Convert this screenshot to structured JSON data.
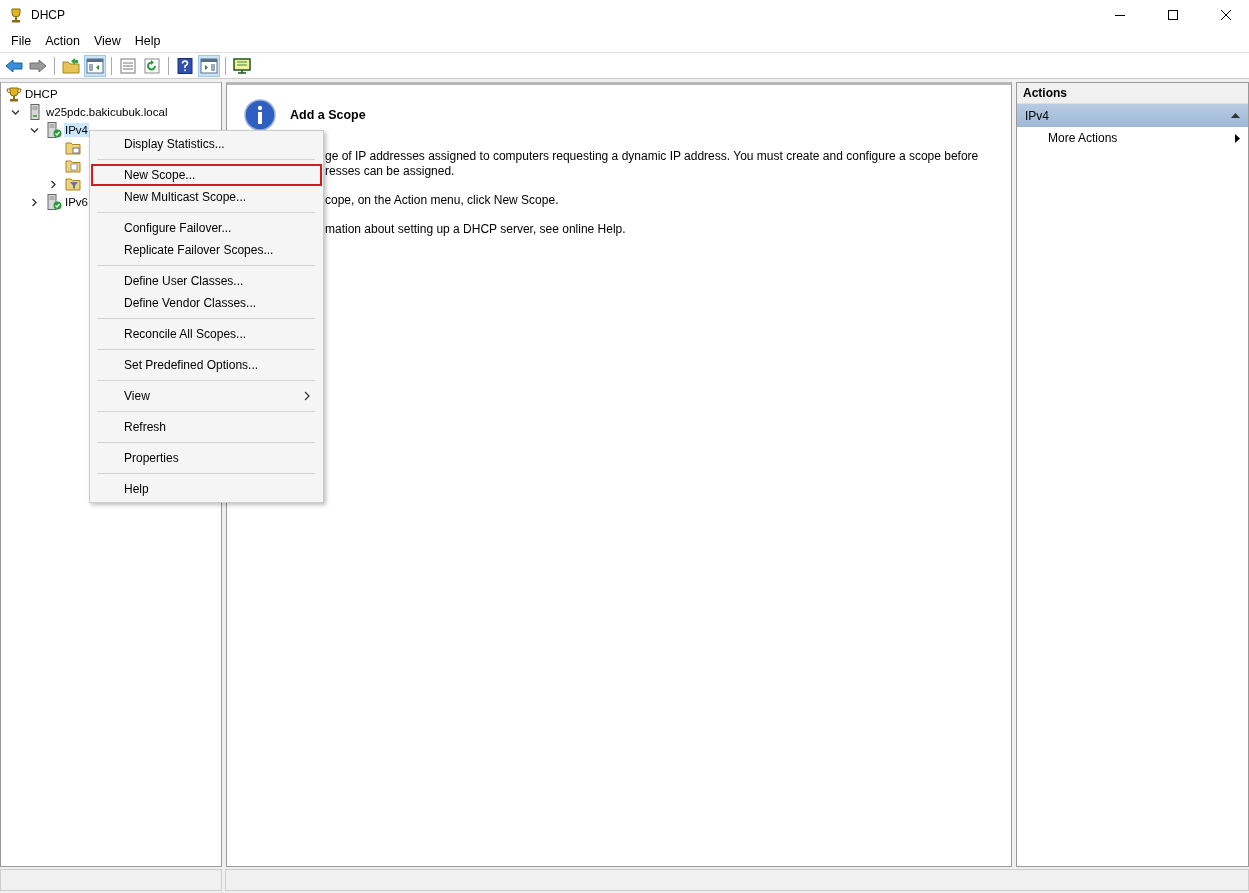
{
  "window": {
    "title": "DHCP"
  },
  "menu_bar": [
    {
      "label": "File"
    },
    {
      "label": "Action"
    },
    {
      "label": "View"
    },
    {
      "label": "Help"
    }
  ],
  "toolbar": [
    {
      "kind": "back",
      "pressed": false
    },
    {
      "kind": "forward",
      "pressed": false
    },
    {
      "kind": "separator"
    },
    {
      "kind": "up",
      "pressed": false
    },
    {
      "kind": "tree-toggle",
      "pressed": true
    },
    {
      "kind": "separator"
    },
    {
      "kind": "export",
      "pressed": false
    },
    {
      "kind": "refresh",
      "pressed": false
    },
    {
      "kind": "separator"
    },
    {
      "kind": "help",
      "pressed": false
    },
    {
      "kind": "action-toggle",
      "pressed": true
    },
    {
      "kind": "separator"
    },
    {
      "kind": "monitor",
      "pressed": false
    }
  ],
  "tree": [
    {
      "label": "DHCP",
      "selected": false,
      "children": [
        {
          "label": "w25pdc.bakicubuk.local",
          "expandable": true,
          "expanded": true,
          "selected": false,
          "children": [
            {
              "label": "IPv4",
              "expandable": true,
              "expanded": true,
              "selected": true,
              "children": [
                {
                  "expandable": false,
                  "selected": false
                },
                {
                  "expandable": false,
                  "selected": false
                },
                {
                  "expandable": true,
                  "expanded": false,
                  "selected": false
                }
              ]
            },
            {
              "label": "IPv6",
              "expandable": true,
              "expanded": false,
              "selected": false
            }
          ]
        }
      ]
    }
  ],
  "content": {
    "heading": "Add a Scope",
    "paragraphs": [
      [
        "ge of IP addresses assigned to computers requesting a dynamic IP address. You must create and configure a scope before",
        "resses can be assigned."
      ],
      [
        "cope, on the Action menu, click New Scope."
      ],
      [
        "mation about setting up a DHCP server, see online Help."
      ]
    ]
  },
  "actions": {
    "title": "Actions",
    "section": "IPv4",
    "items": [
      {
        "label": "More Actions",
        "submenu": true
      }
    ]
  },
  "context_menu": {
    "items": [
      {
        "kind": "item",
        "label": "Display Statistics...",
        "submenu": false,
        "highlighted": false
      },
      {
        "kind": "separator"
      },
      {
        "kind": "item",
        "label": "New Scope...",
        "submenu": false,
        "highlighted": true
      },
      {
        "kind": "item",
        "label": "New Multicast Scope...",
        "submenu": false,
        "highlighted": false
      },
      {
        "kind": "separator"
      },
      {
        "kind": "item",
        "label": "Configure Failover...",
        "submenu": false,
        "highlighted": false
      },
      {
        "kind": "item",
        "label": "Replicate Failover Scopes...",
        "submenu": false,
        "highlighted": false
      },
      {
        "kind": "separator"
      },
      {
        "kind": "item",
        "label": "Define User Classes...",
        "submenu": false,
        "highlighted": false
      },
      {
        "kind": "item",
        "label": "Define Vendor Classes...",
        "submenu": false,
        "highlighted": false
      },
      {
        "kind": "separator"
      },
      {
        "kind": "item",
        "label": "Reconcile All Scopes...",
        "submenu": false,
        "highlighted": false
      },
      {
        "kind": "separator"
      },
      {
        "kind": "item",
        "label": "Set Predefined Options...",
        "submenu": false,
        "highlighted": false
      },
      {
        "kind": "separator"
      },
      {
        "kind": "item",
        "label": "View",
        "submenu": true,
        "highlighted": false
      },
      {
        "kind": "separator"
      },
      {
        "kind": "item",
        "label": "Refresh",
        "submenu": false,
        "highlighted": false
      },
      {
        "kind": "separator"
      },
      {
        "kind": "item",
        "label": "Properties",
        "submenu": false,
        "highlighted": false
      },
      {
        "kind": "separator"
      },
      {
        "kind": "item",
        "label": "Help",
        "submenu": false,
        "highlighted": false
      }
    ]
  }
}
